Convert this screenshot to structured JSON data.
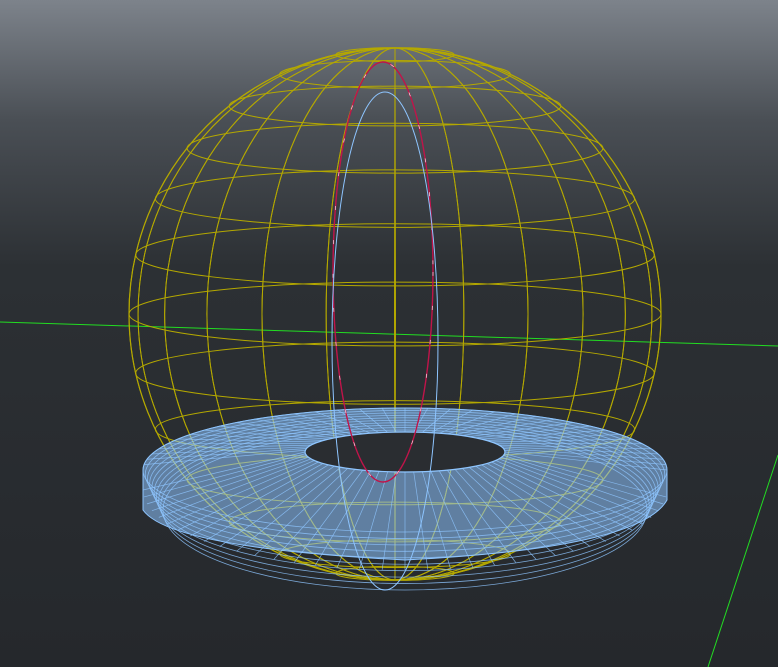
{
  "viewport": {
    "background_top": "#7d838b",
    "background_bottom": "#25282c"
  },
  "scene": {
    "sphere": {
      "type": "wireframe-sphere",
      "color": "#b4a800",
      "latitudes": 14,
      "longitudes": 24
    },
    "torus": {
      "type": "wireframe-torus",
      "color": "#8ec5ff"
    },
    "curves": [
      {
        "type": "ellipse-curve",
        "color": "#c0144a",
        "highlight": "#ffffff"
      },
      {
        "type": "ellipse-curve",
        "color": "#8ec5ff"
      }
    ],
    "grid_axes": [
      {
        "axis": "x",
        "color": "#22dd22"
      },
      {
        "axis": "z",
        "color": "#22dd22"
      }
    ]
  }
}
